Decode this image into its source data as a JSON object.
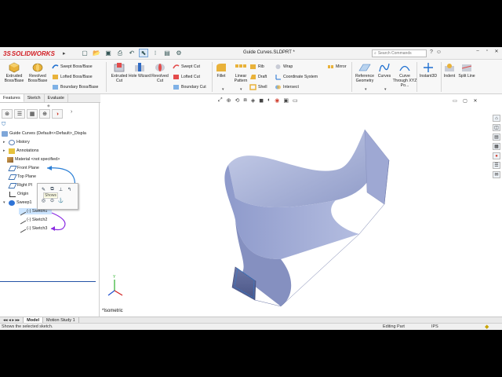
{
  "app": {
    "brand_ds": "3S",
    "brand_name": "SOLIDWORKS",
    "doc_title": "Guide Curves.SLDPRT *"
  },
  "search": {
    "placeholder": "Search Commands"
  },
  "ribbon": {
    "extruded_boss": "Extruded Boss/Base",
    "revolved_boss": "Revolved Boss/Base",
    "swept_boss": "Swept Boss/Base",
    "lofted_boss": "Lofted Boss/Base",
    "boundary_boss": "Boundary Boss/Base",
    "extruded_cut": "Extruded Cut",
    "hole_wizard": "Hole Wizard",
    "revolved_cut": "Revolved Cut",
    "swept_cut": "Swept Cut",
    "lofted_cut": "Lofted Cut",
    "boundary_cut": "Boundary Cut",
    "fillet": "Fillet",
    "linear_pattern": "Linear Pattern",
    "rib": "Rib",
    "draft": "Draft",
    "shell": "Shell",
    "wrap": "Wrap",
    "coordinate_system": "Coordinate System",
    "intersect": "Intersect",
    "mirror": "Mirror",
    "reference_geometry": "Reference Geometry",
    "curves": "Curves",
    "curve_through": "Curve Through XYZ Po...",
    "instant3d": "Instant3D",
    "indent": "Indent",
    "split_line": "Split Line"
  },
  "tabs": [
    "Features",
    "Sketch",
    "Evaluate"
  ],
  "tree": {
    "root": "Guide Curves  (Default<<Default>_Displa",
    "history": "History",
    "annotations": "Annotations",
    "material": "Material <not specified>",
    "front_plane": "Front Plane",
    "top_plane": "Top Plane",
    "right_plane": "Right Pl",
    "origin": "Origin",
    "sweep": "Sweep1",
    "sketch1": "(-) Sketch1",
    "sketch2": "(-) Sketch2",
    "sketch3": "(-) Sketch3"
  },
  "tooltip": "Shows",
  "viewport": {
    "view_label": "*Isometric"
  },
  "bottom_tabs": [
    "Model",
    "Motion Study 1"
  ],
  "status": {
    "message": "Shows the selected sketch.",
    "mode": "Editing Part",
    "units": "IPS"
  },
  "colors": {
    "part": "#9aa6ce",
    "accent": "#2452a6",
    "brand": "#d21f25",
    "annotation": "#8a2be2"
  }
}
